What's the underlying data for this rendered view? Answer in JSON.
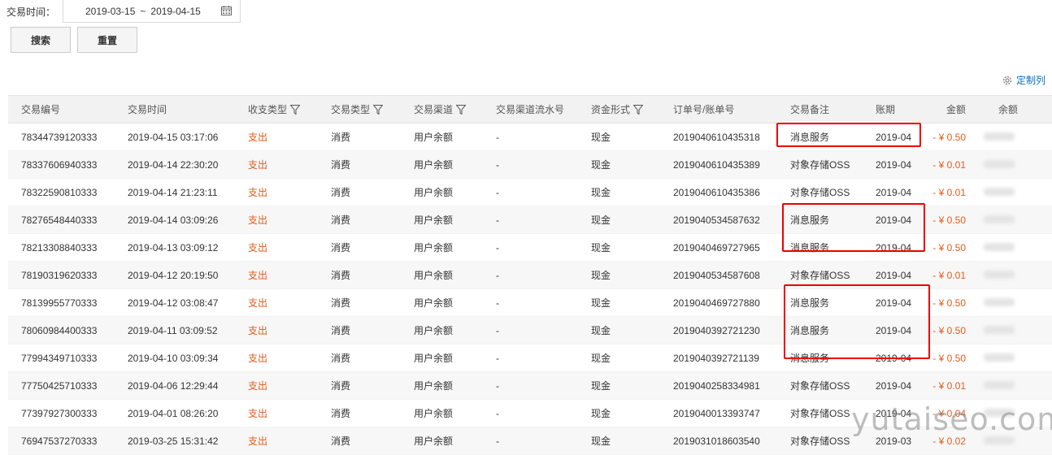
{
  "filter": {
    "label": "交易时间：",
    "date_start": "2019-03-15",
    "date_sep": "~",
    "date_end": "2019-04-15",
    "calendar_icon": "calendar-icon"
  },
  "buttons": {
    "search": "搜索",
    "reset": "重置"
  },
  "custom_columns": "定制列",
  "table": {
    "headers": [
      "交易编号",
      "交易时间",
      "收支类型",
      "交易类型",
      "交易渠道",
      "交易渠道流水号",
      "资金形式",
      "订单号/账单号",
      "交易备注",
      "账期",
      "金额",
      "余额"
    ],
    "rows": [
      [
        "78344739120333",
        "2019-04-15 03:17:06",
        "支出",
        "消费",
        "用户余额",
        "-",
        "现金",
        "2019040610435318",
        "消息服务",
        "2019-04",
        "- ¥ 0.50"
      ],
      [
        "78337606940333",
        "2019-04-14 22:30:20",
        "支出",
        "消费",
        "用户余额",
        "-",
        "现金",
        "2019040610435389",
        "对象存储OSS",
        "2019-04",
        "- ¥ 0.01"
      ],
      [
        "78322590810333",
        "2019-04-14 21:23:11",
        "支出",
        "消费",
        "用户余额",
        "-",
        "现金",
        "2019040610435386",
        "对象存储OSS",
        "2019-04",
        "- ¥ 0.01"
      ],
      [
        "78276548440333",
        "2019-04-14 03:09:26",
        "支出",
        "消费",
        "用户余额",
        "-",
        "现金",
        "2019040534587632",
        "消息服务",
        "2019-04",
        "- ¥ 0.50"
      ],
      [
        "78213308840333",
        "2019-04-13 03:09:12",
        "支出",
        "消费",
        "用户余额",
        "-",
        "现金",
        "2019040469727965",
        "消息服务",
        "2019-04",
        "- ¥ 0.50"
      ],
      [
        "78190319620333",
        "2019-04-12 20:19:50",
        "支出",
        "消费",
        "用户余额",
        "-",
        "现金",
        "2019040534587608",
        "对象存储OSS",
        "2019-04",
        "- ¥ 0.01"
      ],
      [
        "78139955770333",
        "2019-04-12 03:08:47",
        "支出",
        "消费",
        "用户余额",
        "-",
        "现金",
        "2019040469727880",
        "消息服务",
        "2019-04",
        "- ¥ 0.50"
      ],
      [
        "78060984400333",
        "2019-04-11 03:09:52",
        "支出",
        "消费",
        "用户余额",
        "-",
        "现金",
        "2019040392721230",
        "消息服务",
        "2019-04",
        "- ¥ 0.50"
      ],
      [
        "77994349710333",
        "2019-04-10 03:09:34",
        "支出",
        "消费",
        "用户余额",
        "-",
        "现金",
        "2019040392721139",
        "消息服务",
        "2019-04",
        "- ¥ 0.50"
      ],
      [
        "77750425710333",
        "2019-04-06 12:29:44",
        "支出",
        "消费",
        "用户余额",
        "-",
        "现金",
        "2019040258334981",
        "对象存储OSS",
        "2019-04",
        "- ¥ 0.01"
      ],
      [
        "77397927300333",
        "2019-04-01 08:26:20",
        "支出",
        "消费",
        "用户余额",
        "-",
        "现金",
        "2019040013393747",
        "对象存储OSS",
        "2019-04",
        "- ¥ 0.04"
      ],
      [
        "76947537270333",
        "2019-03-25 15:31:42",
        "支出",
        "消费",
        "用户余额",
        "-",
        "现金",
        "2019031018603540",
        "对象存储OSS",
        "2019-03",
        "- ¥ 0.02"
      ]
    ]
  },
  "watermark": "yutaiseo.com",
  "colors": {
    "expense": "#e25c1c",
    "link": "#0a6fc2",
    "highlight": "#e00000"
  }
}
